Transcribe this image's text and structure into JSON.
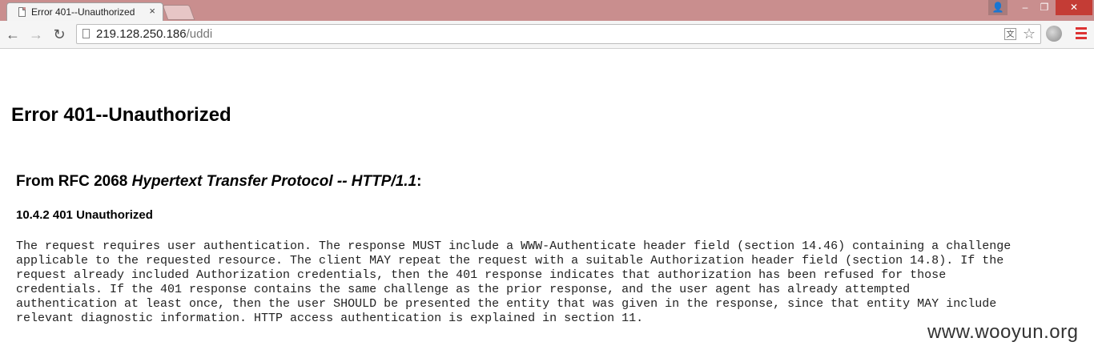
{
  "browser": {
    "tab_title": "Error 401--Unauthorized",
    "tab_close": "×",
    "url_host": "219.128.250.186",
    "url_path": "/uddi",
    "window_buttons": {
      "minimize": "–",
      "maximize": "❐",
      "close": "✕",
      "user": "👤"
    },
    "icons": {
      "back": "←",
      "forward": "→",
      "reload": "↻",
      "star": "☆",
      "translate": "文"
    }
  },
  "page": {
    "heading": "Error 401--Unauthorized",
    "rfc_prefix": "From RFC 2068 ",
    "rfc_title": "Hypertext Transfer Protocol -- HTTP/1.1",
    "rfc_suffix": ":",
    "section_heading": "10.4.2 401 Unauthorized",
    "body": "The request requires user authentication. The response MUST include a WWW-Authenticate header field (section 14.46) containing a challenge\napplicable to the requested resource. The client MAY repeat the request with a suitable Authorization header field (section 14.8). If the\nrequest already included Authorization credentials, then the 401 response indicates that authorization has been refused for those\ncredentials. If the 401 response contains the same challenge as the prior response, and the user agent has already attempted\nauthentication at least once, then the user SHOULD be presented the entity that was given in the response, since that entity MAY include\nrelevant diagnostic information. HTTP access authentication is explained in section 11.",
    "watermark": "www.wooyun.org"
  }
}
